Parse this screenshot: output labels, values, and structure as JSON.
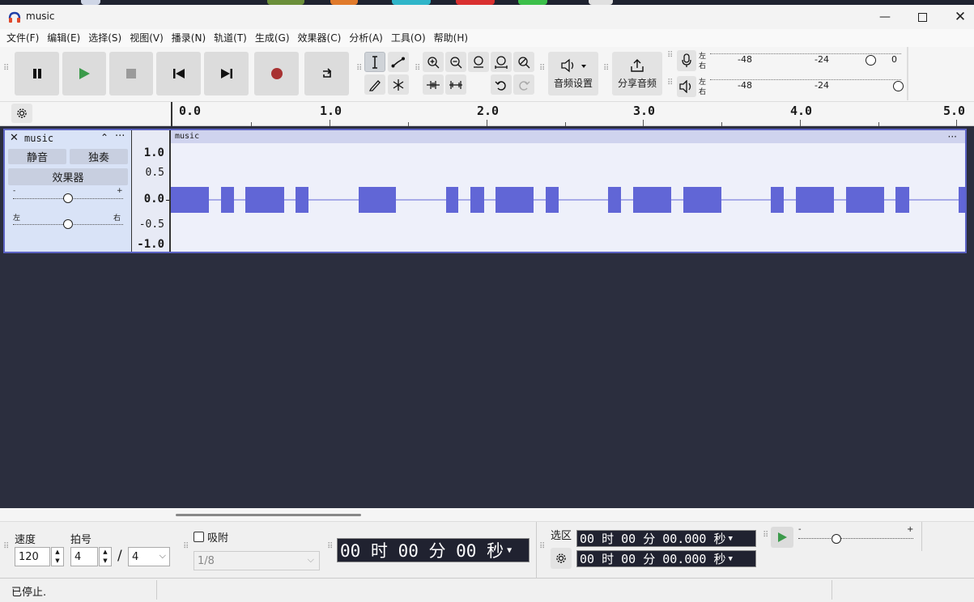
{
  "window": {
    "title": "music"
  },
  "menu": [
    "文件(F)",
    "编辑(E)",
    "选择(S)",
    "视图(V)",
    "播录(N)",
    "轨道(T)",
    "生成(G)",
    "效果器(C)",
    "分析(A)",
    "工具(O)",
    "帮助(H)"
  ],
  "toolbar": {
    "audio_setup_label": "音频设置",
    "share_audio_label": "分享音频",
    "meter_rec_ticks": [
      "-48",
      "-24",
      "0"
    ],
    "meter_play_ticks": [
      "-48",
      "-24"
    ],
    "meter_lr_top": "左",
    "meter_lr_bottom": "右"
  },
  "ruler": {
    "labels": [
      "0.0",
      "1.0",
      "2.0",
      "3.0",
      "4.0",
      "5.0"
    ]
  },
  "track": {
    "name": "music",
    "mute_label": "静音",
    "solo_label": "独奏",
    "effects_label": "效果器",
    "gain_minus": "-",
    "gain_plus": "+",
    "pan_left": "左",
    "pan_right": "右",
    "clip_name": "music",
    "scale_labels": [
      "1.0",
      "0.5",
      "0.0",
      "-0.5",
      "-1.0"
    ]
  },
  "bottom": {
    "tempo_label": "速度",
    "tempo_value": "120",
    "beats_label": "拍号",
    "beats_upper": "4",
    "beats_separator": "/",
    "beats_lower": "4",
    "snap_label": "吸附",
    "snap_value": "1/8",
    "time_display": "00 时 00 分 00 秒",
    "selection_label": "选区",
    "selection_start": "00 时 00 分 00.000 秒",
    "selection_end": "00 时 00 分 00.000 秒",
    "speed_minus": "-",
    "speed_plus": "+"
  },
  "status": {
    "text": "已停止."
  },
  "colors": {
    "waveform": "#6166d6",
    "track_border": "#5c63c4",
    "track_bg": "#2b2e3e",
    "record": "#a83232",
    "play": "#3b9a4a"
  }
}
